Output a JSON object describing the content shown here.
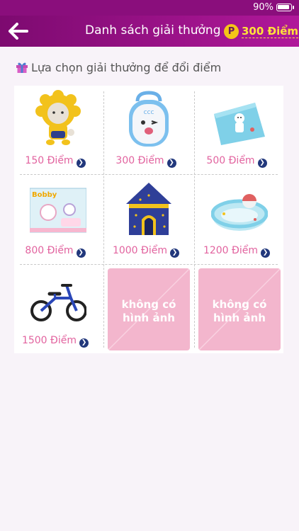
{
  "status": {
    "battery": "90%"
  },
  "header": {
    "title": "Danh sách giải thưởng",
    "points_label": "300 Điểm",
    "points_icon": "P"
  },
  "section": {
    "title": "Lựa chọn giải thưởng để đổi điểm"
  },
  "rewards": [
    {
      "icon": "plush-toy-image",
      "price": "150 Điểm"
    },
    {
      "icon": "backpack-image",
      "price": "300 Điểm"
    },
    {
      "icon": "baby-towel-image",
      "price": "500 Điểm"
    },
    {
      "icon": "bobby-giftbox-image",
      "price": "800 Điểm"
    },
    {
      "icon": "play-tent-image",
      "price": "1000 Điểm"
    },
    {
      "icon": "inflatable-pool-image",
      "price": "1200 Điểm"
    },
    {
      "icon": "balance-bike-image",
      "price": "1500 Điểm"
    },
    {
      "icon": "no-image",
      "placeholder": "không có\nhình ảnh"
    },
    {
      "icon": "no-image",
      "placeholder": "không có\nhình ảnh"
    }
  ],
  "colors": {
    "header": "#8a0e7c",
    "price": "#e2639f",
    "points": "#ffe33a",
    "placeholder": "#f3b6cd"
  }
}
